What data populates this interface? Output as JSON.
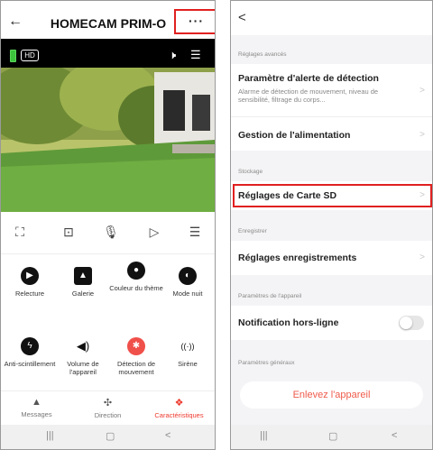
{
  "left": {
    "title": "HOMECAM PRIM-O",
    "back_icon": "←",
    "more_icon": "···",
    "hd_label": "HD",
    "features": [
      {
        "label": "Relecture",
        "icon": "play-icon",
        "glyph": "▶"
      },
      {
        "label": "Galerie",
        "icon": "image-icon",
        "glyph": "▲"
      },
      {
        "label": "Couleur du thème",
        "icon": "palette-icon",
        "glyph": "●"
      },
      {
        "label": "Mode nuit",
        "icon": "moon-icon",
        "glyph": "◐"
      },
      {
        "label": "Anti-scintillement",
        "icon": "bolt-icon",
        "glyph": "ϟ"
      },
      {
        "label": "Volume de l'appareil",
        "icon": "speaker-icon",
        "glyph": "◀)"
      },
      {
        "label": "Détection de mouvement",
        "icon": "motion-icon",
        "glyph": "✱"
      },
      {
        "label": "Sirène",
        "icon": "siren-icon",
        "glyph": "((·))"
      }
    ],
    "tabs": [
      {
        "label": "Messages",
        "icon": "bell-icon",
        "glyph": "▲"
      },
      {
        "label": "Direction",
        "icon": "dpad-icon",
        "glyph": "✣"
      },
      {
        "label": "Caractéristiques",
        "icon": "features-icon",
        "glyph": "❖"
      }
    ]
  },
  "right": {
    "back_icon": "<",
    "sections": {
      "advanced": "Réglages avancés",
      "storage": "Stockage",
      "record": "Enregistrer",
      "device": "Paramètres de l'appareil",
      "general": "Paramètres généraux"
    },
    "items": {
      "alert_title": "Paramètre d'alerte de détection",
      "alert_sub": "Alarme de détection de mouvement, niveau de sensibilité, filtrage du corps...",
      "power": "Gestion de l'alimentation",
      "sd": "Réglages de Carte SD",
      "recordings": "Réglages enregistrements",
      "offline": "Notification hors-ligne"
    },
    "offline_toggle_on": false,
    "remove": "Enlevez l'appareil"
  },
  "nav": {
    "recent": "|||",
    "home": "▢",
    "back": "<"
  },
  "colors": {
    "accent": "#ee3a2e",
    "highlight": "#e02020"
  }
}
